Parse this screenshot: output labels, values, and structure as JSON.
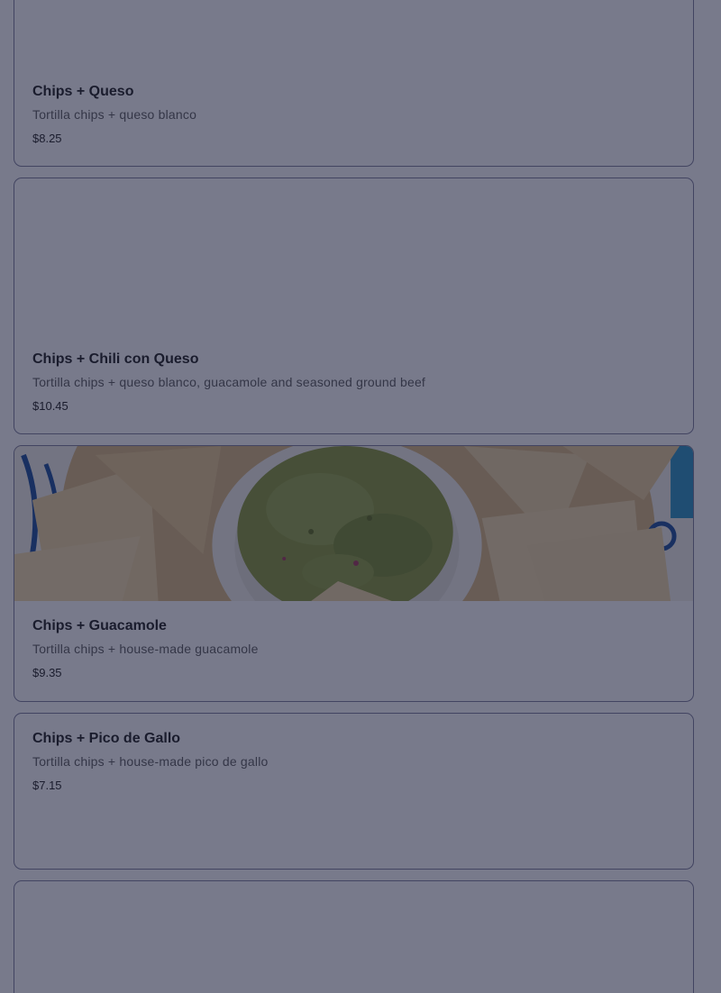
{
  "menu_items": [
    {
      "name": "Chips + Queso",
      "description": "Tortilla chips + queso blanco",
      "price": "$8.25"
    },
    {
      "name": "Chips + Chili con Queso",
      "description": "Tortilla chips + queso blanco, guacamole and seasoned ground beef",
      "price": "$10.45"
    },
    {
      "name": "Chips + Guacamole",
      "description": "Tortilla chips + house-made guacamole",
      "price": "$9.35"
    },
    {
      "name": "Chips + Pico de Gallo",
      "description": "Tortilla chips + house-made pico de gallo",
      "price": "$7.15"
    }
  ],
  "colors": {
    "card_border": "#7e7f9c",
    "overlay": "#161937",
    "guacamole": "#8a9a3a",
    "chips": "#e8c98c",
    "plate_blue": "#1e4f9c"
  }
}
